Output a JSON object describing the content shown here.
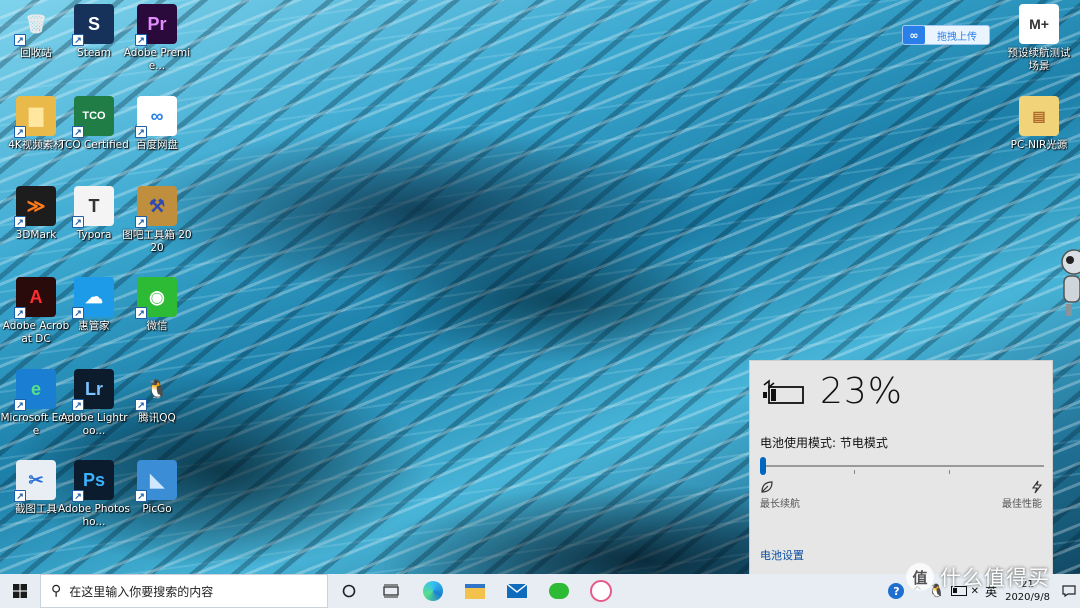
{
  "desktop": {
    "icons": [
      {
        "label": "回收站",
        "glyph": "🗑",
        "bg": "transparent",
        "color": "#eaeaea",
        "icon": "recycle-bin-icon"
      },
      {
        "label": "Steam",
        "glyph": "S",
        "bg": "#17325a",
        "color": "#ffffff",
        "icon": "steam-icon"
      },
      {
        "label": "Adobe Premie...",
        "glyph": "Pr",
        "bg": "#2a0a3a",
        "color": "#e38cff",
        "icon": "premiere-icon"
      },
      {
        "label": "4K视频素材",
        "glyph": "▇",
        "bg": "#e9b949",
        "color": "#ffe7a0",
        "icon": "folder-icon"
      },
      {
        "label": "TCO Certified",
        "glyph": "TCO",
        "bg": "#1f7d45",
        "color": "#ffffff",
        "icon": "tco-icon"
      },
      {
        "label": "百度网盘",
        "glyph": "∞",
        "bg": "#ffffff",
        "color": "#2b7fe8",
        "icon": "baidu-netdisk-icon"
      },
      {
        "label": "3DMark",
        "glyph": "≫",
        "bg": "#1d1d1d",
        "color": "#ff7a1a",
        "icon": "3dmark-icon"
      },
      {
        "label": "Typora",
        "glyph": "T",
        "bg": "#f4f4f4",
        "color": "#333333",
        "icon": "typora-icon"
      },
      {
        "label": "图吧工具箱 2020",
        "glyph": "⚒",
        "bg": "#c08f3e",
        "color": "#2f4ab0",
        "icon": "toolbox-icon"
      },
      {
        "label": "Adobe Acrobat DC",
        "glyph": "A",
        "bg": "#2a0b0b",
        "color": "#ff2d2d",
        "icon": "acrobat-icon"
      },
      {
        "label": "惠管家",
        "glyph": "☁",
        "bg": "#1d9be8",
        "color": "#ffffff",
        "icon": "cloud-manager-icon"
      },
      {
        "label": "微信",
        "glyph": "◉",
        "bg": "#2dbb35",
        "color": "#ffffff",
        "icon": "wechat-icon"
      },
      {
        "label": "Microsoft Edge",
        "glyph": "e",
        "bg": "#1a7fd2",
        "color": "#59e08a",
        "icon": "edge-icon"
      },
      {
        "label": "Adobe Lightroo...",
        "glyph": "Lr",
        "bg": "#0c1c2d",
        "color": "#7ec3ff",
        "icon": "lightroom-icon"
      },
      {
        "label": "腾讯QQ",
        "glyph": "🐧",
        "bg": "transparent",
        "color": "#111111",
        "icon": "qq-icon"
      },
      {
        "label": "截图工具",
        "glyph": "✂",
        "bg": "#e9eef5",
        "color": "#2a6fd6",
        "icon": "snipping-tool-icon"
      },
      {
        "label": "Adobe Photosho...",
        "glyph": "Ps",
        "bg": "#0b1c2f",
        "color": "#3ab2ff",
        "icon": "photoshop-icon"
      },
      {
        "label": "PicGo",
        "glyph": "◣",
        "bg": "#3b8ed6",
        "color": "#cfe8ff",
        "icon": "picgo-icon"
      }
    ],
    "right_icons": [
      {
        "label": "预设续航测试场景",
        "glyph": "M+",
        "bg": "#ffffff",
        "color": "#333333",
        "icon": "markdown-file-icon"
      },
      {
        "label": "PC-NIR光源",
        "glyph": "▤",
        "bg": "#f1d37a",
        "color": "#b06b2a",
        "icon": "zip-folder-icon"
      }
    ]
  },
  "baidu_float": {
    "label": "拖拽上传"
  },
  "battery": {
    "percent": "23%",
    "mode_label": "电池使用模式: 节电模式",
    "slider_fraction": 0.0,
    "left_label": "最长续航",
    "right_label": "最佳性能",
    "settings_link": "电池设置"
  },
  "taskbar": {
    "search_placeholder": "在这里输入你要搜索的内容",
    "ime": "英",
    "time": "21",
    "date": "2020/9/8"
  },
  "watermark": {
    "text": "什么值得买"
  },
  "colors": {
    "accent": "#0067c0",
    "link": "#0a4fa0",
    "flyout_bg": "#e6e6e6",
    "taskbar_bg": "#e7edf2"
  }
}
